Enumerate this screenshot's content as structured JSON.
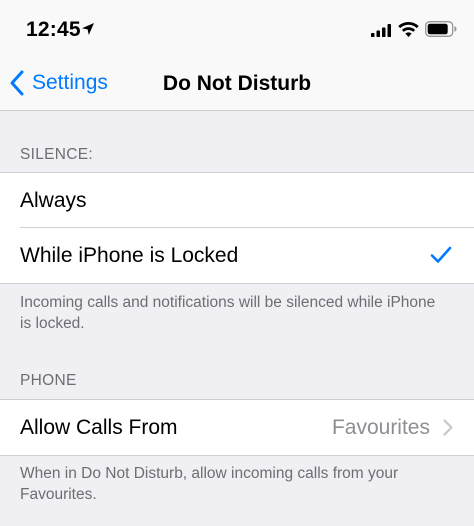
{
  "status_bar": {
    "time": "12:45",
    "icons": [
      "location-arrow-icon",
      "cellular-signal-icon",
      "wifi-icon",
      "battery-icon"
    ]
  },
  "nav": {
    "back_label": "Settings",
    "title": "Do Not Disturb"
  },
  "silence_section": {
    "header": "SILENCE:",
    "options": [
      {
        "label": "Always",
        "selected": false
      },
      {
        "label": "While iPhone is Locked",
        "selected": true
      }
    ],
    "footer": "Incoming calls and notifications will be silenced while iPhone is locked."
  },
  "phone_section": {
    "header": "PHONE",
    "allow_calls": {
      "label": "Allow Calls From",
      "value": "Favourites"
    },
    "footer": "When in Do Not Disturb, allow incoming calls from your Favourites."
  },
  "colors": {
    "accent": "#007aff",
    "background": "#efeff4",
    "secondary_text": "#6d6d72",
    "value_text": "#8e8e93"
  }
}
